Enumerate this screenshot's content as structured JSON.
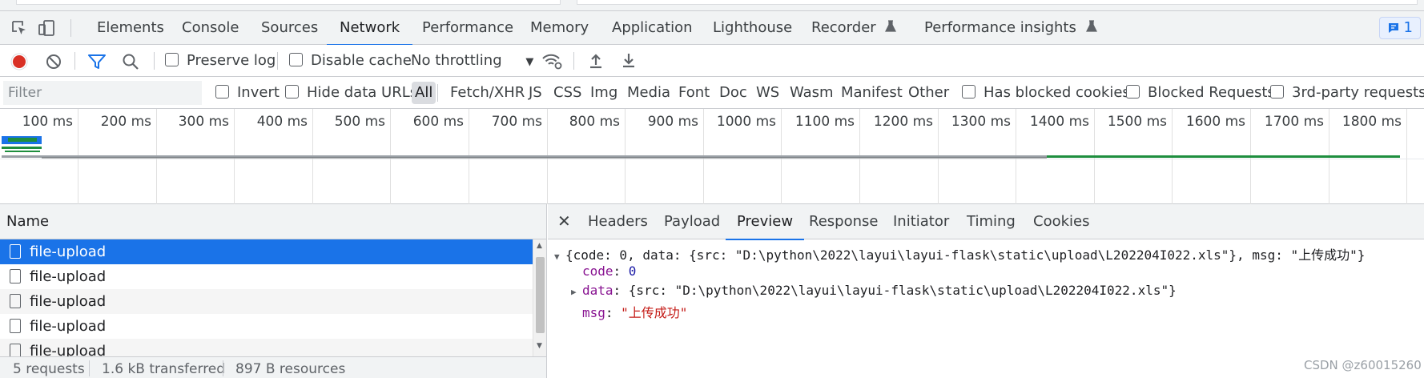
{
  "tabs": [
    "Elements",
    "Console",
    "Sources",
    "Network",
    "Performance",
    "Memory",
    "Application",
    "Lighthouse",
    "Recorder",
    "Performance insights"
  ],
  "active_tab": "Network",
  "issues_count": "1",
  "toolbar": {
    "preserve_log": "Preserve log",
    "disable_cache": "Disable cache",
    "throttling": "No throttling"
  },
  "filter": {
    "placeholder": "Filter",
    "invert": "Invert",
    "hide_data_urls": "Hide data URLs",
    "types": [
      "All",
      "Fetch/XHR",
      "JS",
      "CSS",
      "Img",
      "Media",
      "Font",
      "Doc",
      "WS",
      "Wasm",
      "Manifest",
      "Other"
    ],
    "has_blocked_cookies": "Has blocked cookies",
    "blocked_requests": "Blocked Requests",
    "third_party": "3rd-party requests"
  },
  "timeline": {
    "ticks": [
      "100 ms",
      "200 ms",
      "300 ms",
      "400 ms",
      "500 ms",
      "600 ms",
      "700 ms",
      "800 ms",
      "900 ms",
      "1000 ms",
      "1100 ms",
      "1200 ms",
      "1300 ms",
      "1400 ms",
      "1500 ms",
      "1600 ms",
      "1700 ms",
      "1800 ms"
    ]
  },
  "requests": {
    "header": "Name",
    "rows": [
      "file-upload",
      "file-upload",
      "file-upload",
      "file-upload",
      "file-upload"
    ]
  },
  "status": {
    "requests": "5 requests",
    "transferred": "1.6 kB transferred",
    "resources": "897 B resources"
  },
  "detail": {
    "tabs": [
      "Headers",
      "Payload",
      "Preview",
      "Response",
      "Initiator",
      "Timing",
      "Cookies"
    ],
    "active_tab": "Preview",
    "preview": {
      "summary_open": "{code: 0, data: {src: \"D:\\python\\2022\\layui\\layui-flask\\static\\upload\\L202204I022.xls\"}, msg: \"上传成功\"}",
      "code_key": "code",
      "code_value": "0",
      "data_key": "data",
      "data_value": "{src: \"D:\\python\\2022\\layui\\layui-flask\\static\\upload\\L202204I022.xls\"}",
      "msg_key": "msg",
      "msg_value": "\"上传成功\""
    }
  },
  "watermark": "CSDN @z60015260",
  "colors": {
    "accent": "#1a73e8",
    "record": "#d93025",
    "bar_green": "#1e8e3e",
    "bar_gray": "#9aa0a6"
  }
}
